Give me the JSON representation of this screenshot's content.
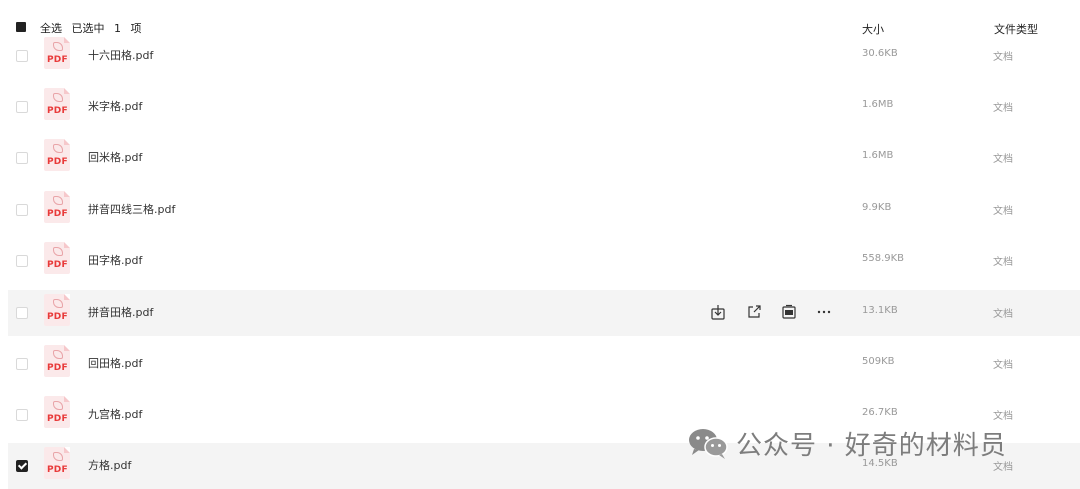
{
  "header": {
    "select_all": "全选",
    "selected_text": "已选中",
    "selected_count": "1",
    "selected_unit": "项",
    "col_size": "大小",
    "col_type": "文件类型"
  },
  "icon_label": "PDF",
  "files": [
    {
      "name": "十六田格.pdf",
      "size": "30.6KB",
      "type": "文档",
      "checked": false
    },
    {
      "name": "米字格.pdf",
      "size": "1.6MB",
      "type": "文档",
      "checked": false
    },
    {
      "name": "回米格.pdf",
      "size": "1.6MB",
      "type": "文档",
      "checked": false
    },
    {
      "name": "拼音四线三格.pdf",
      "size": "9.9KB",
      "type": "文档",
      "checked": false
    },
    {
      "name": "田字格.pdf",
      "size": "558.9KB",
      "type": "文档",
      "checked": false
    },
    {
      "name": "拼音田格.pdf",
      "size": "13.1KB",
      "type": "文档",
      "checked": false,
      "hover": true
    },
    {
      "name": "回田格.pdf",
      "size": "509KB",
      "type": "文档",
      "checked": false
    },
    {
      "name": "九宫格.pdf",
      "size": "26.7KB",
      "type": "文档",
      "checked": false
    },
    {
      "name": "方格.pdf",
      "size": "14.5KB",
      "type": "文档",
      "checked": true
    }
  ],
  "row_actions": [
    "download-icon",
    "open-external-icon",
    "pdf-convert-icon",
    "more-icon"
  ],
  "watermark": {
    "text": "公众号 · 好奇的材料员",
    "icon": "wechat-icon"
  },
  "colors": {
    "pdf_red": "#e83a3a",
    "hover_bg": "#f4f4f4",
    "muted_text": "#999999"
  }
}
